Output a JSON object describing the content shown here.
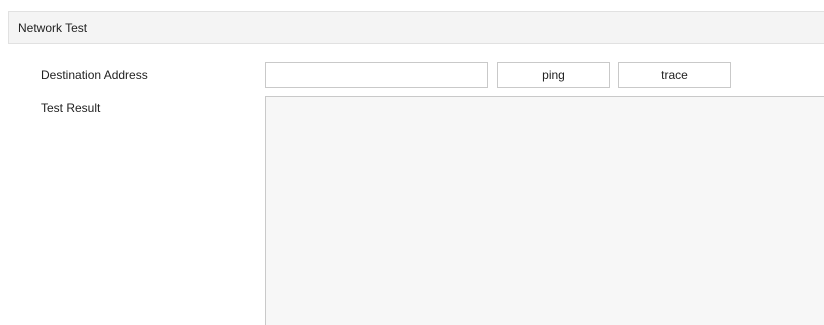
{
  "section": {
    "title": "Network Test"
  },
  "form": {
    "destination_label": "Destination Address",
    "destination_value": "",
    "ping_label": "ping",
    "trace_label": "trace",
    "result_label": "Test Result",
    "result_value": ""
  }
}
